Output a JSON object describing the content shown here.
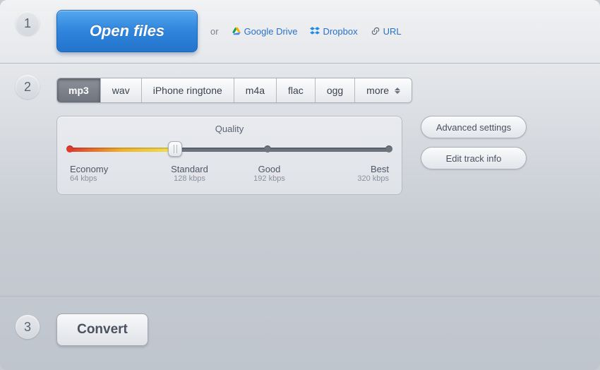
{
  "steps": {
    "one": "1",
    "two": "2",
    "three": "3"
  },
  "step1": {
    "open_label": "Open files",
    "or_label": "or",
    "links": {
      "gdrive": "Google Drive",
      "dropbox": "Dropbox",
      "url": "URL"
    }
  },
  "step2": {
    "formats": {
      "mp3": "mp3",
      "wav": "wav",
      "iphone": "iPhone ringtone",
      "m4a": "m4a",
      "flac": "flac",
      "ogg": "ogg",
      "more": "more",
      "selected": "mp3"
    },
    "quality": {
      "title": "Quality",
      "value_percent": 33,
      "marks": [
        {
          "label": "Economy",
          "kbps": "64 kbps"
        },
        {
          "label": "Standard",
          "kbps": "128 kbps"
        },
        {
          "label": "Good",
          "kbps": "192 kbps"
        },
        {
          "label": "Best",
          "kbps": "320 kbps"
        }
      ]
    },
    "buttons": {
      "advanced": "Advanced settings",
      "trackinfo": "Edit track info"
    }
  },
  "step3": {
    "convert_label": "Convert"
  }
}
